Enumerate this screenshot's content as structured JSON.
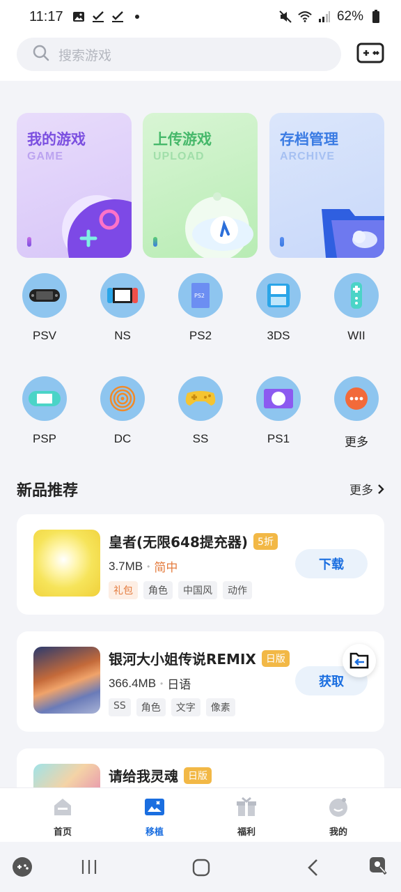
{
  "status": {
    "time": "11:17",
    "battery": "62%"
  },
  "search": {
    "placeholder": "搜索游戏"
  },
  "feature_cards": [
    {
      "title": "我的游戏",
      "subtitle": "GAME",
      "title_color": "#7b4fe0"
    },
    {
      "title": "上传游戏",
      "subtitle": "UPLOAD",
      "title_color": "#46b86a"
    },
    {
      "title": "存档管理",
      "subtitle": "ARCHIVE",
      "title_color": "#3a7be3"
    }
  ],
  "platforms": [
    {
      "label": "PSV",
      "icon": "psv-handheld-icon"
    },
    {
      "label": "NS",
      "icon": "switch-console-icon"
    },
    {
      "label": "PS2",
      "icon": "ps2-console-icon"
    },
    {
      "label": "3DS",
      "icon": "3ds-handheld-icon"
    },
    {
      "label": "WII",
      "icon": "wii-remote-icon"
    },
    {
      "label": "PSP",
      "icon": "psp-handheld-icon"
    },
    {
      "label": "DC",
      "icon": "dreamcast-swirl-icon"
    },
    {
      "label": "SS",
      "icon": "saturn-controller-icon"
    },
    {
      "label": "PS1",
      "icon": "ps1-console-icon"
    },
    {
      "label": "更多",
      "icon": "more-dots-icon"
    }
  ],
  "section": {
    "title": "新品推荐",
    "more": "更多"
  },
  "games": [
    {
      "name": "皇者(无限648提充器)",
      "badge": "5折",
      "size": "3.7MB",
      "lang": "简中",
      "tags": [
        "礼包",
        "角色",
        "中国风",
        "动作"
      ],
      "action": "下载"
    },
    {
      "name": "银河大小姐传说REMIX",
      "badge": "日版",
      "size": "366.4MB",
      "lang": "日语",
      "tags": [
        "SS",
        "角色",
        "文字",
        "像素"
      ],
      "action": "获取"
    },
    {
      "name": "请给我灵魂",
      "badge": "日版"
    }
  ],
  "tabs": [
    {
      "label": "首页",
      "icon": "home-icon"
    },
    {
      "label": "移植",
      "icon": "port-icon"
    },
    {
      "label": "福利",
      "icon": "gift-icon"
    },
    {
      "label": "我的",
      "icon": "profile-icon"
    }
  ],
  "colors": {
    "accent": "#1a6ee0",
    "platform_circle": "#8ec5ef",
    "badge": "#f2b846"
  }
}
